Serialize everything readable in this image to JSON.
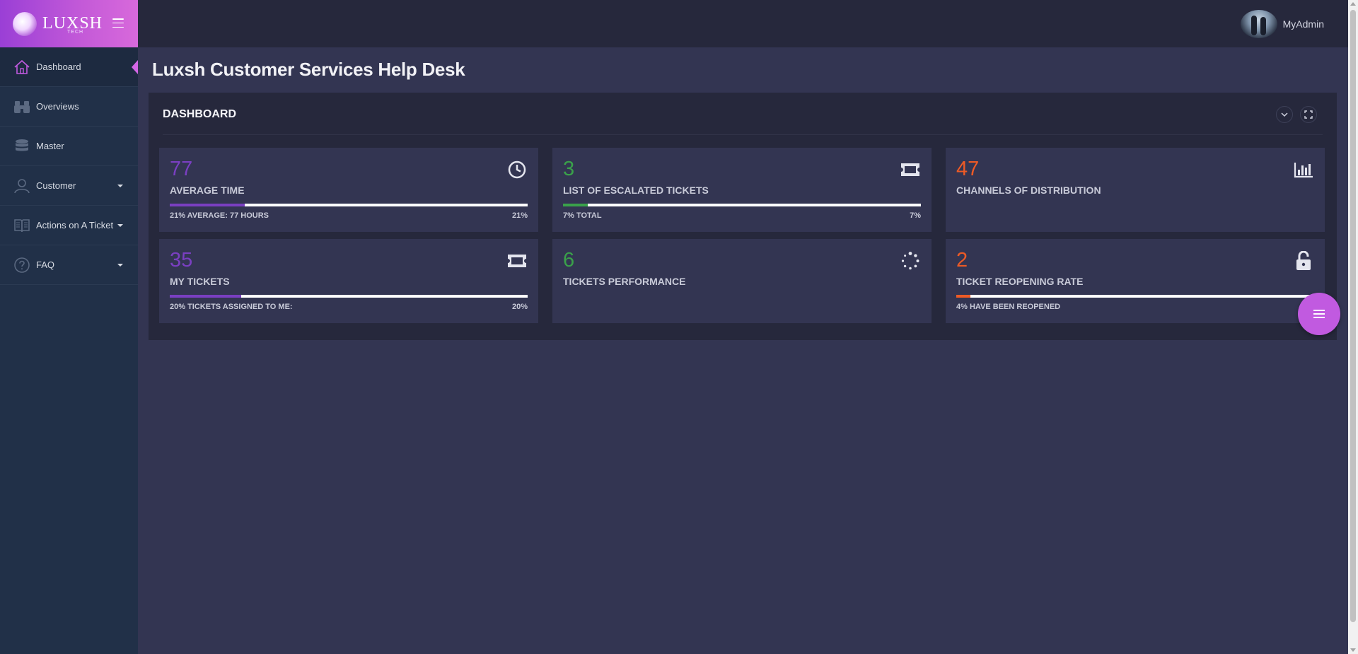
{
  "brand": {
    "name": "LUXSH",
    "sub": "TECH"
  },
  "sidebar": {
    "items": [
      {
        "label": "Dashboard"
      },
      {
        "label": "Overviews"
      },
      {
        "label": "Master"
      },
      {
        "label": "Customer"
      },
      {
        "label": "Actions on A Ticket"
      },
      {
        "label": "FAQ"
      }
    ]
  },
  "user": {
    "name": "MyAdmin"
  },
  "page": {
    "title": "Luxsh Customer Services Help Desk"
  },
  "panel": {
    "title": "DASHBOARD"
  },
  "tiles": [
    {
      "value": "77",
      "label": "AVERAGE TIME",
      "foot_left": "21% AVERAGE: 77 HOURS",
      "foot_right": "21%",
      "progress": 0.21,
      "icon": "clock-icon"
    },
    {
      "value": "3",
      "label": "LIST OF ESCALATED TICKETS",
      "foot_left": "7% TOTAL",
      "foot_right": "7%",
      "progress": 0.07,
      "icon": "ticket-icon"
    },
    {
      "value": "47",
      "label": "CHANNELS OF DISTRIBUTION",
      "icon": "bar-chart-icon"
    },
    {
      "value": "35",
      "label": "MY TICKETS",
      "foot_left": "20% TICKETS ASSIGNED TO ME:",
      "foot_right": "20%",
      "progress": 0.2,
      "icon": "ticket-icon"
    },
    {
      "value": "6",
      "label": "TICKETS PERFORMANCE",
      "icon": "spinner-icon"
    },
    {
      "value": "2",
      "label": "TICKET REOPENING RATE",
      "foot_left": "4% HAVE BEEN REOPENED",
      "progress": 0.04,
      "icon": "unlock-icon"
    }
  ],
  "colors": {
    "accent": "#c15ae0",
    "purple": "#7a3fc1",
    "green": "#3aa14a",
    "orange": "#ec5a26"
  }
}
